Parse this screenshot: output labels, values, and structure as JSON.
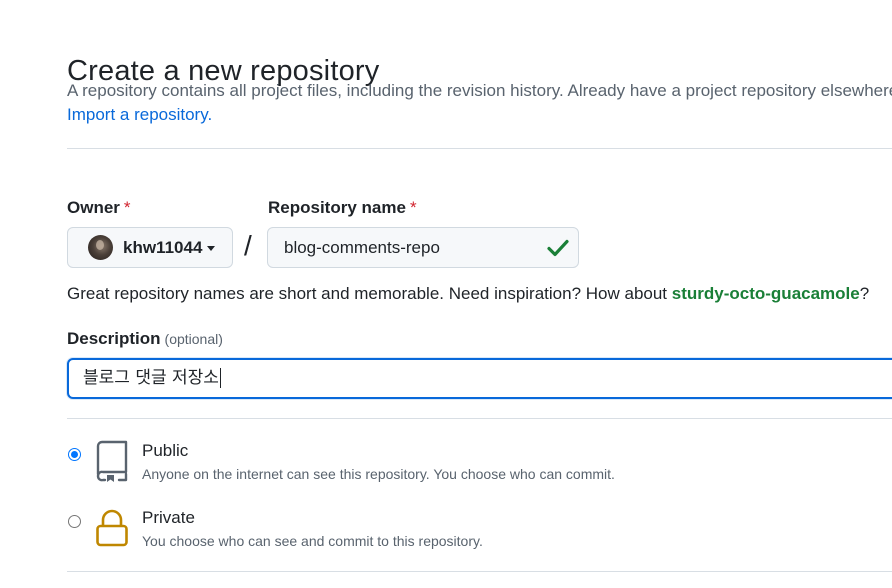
{
  "page": {
    "title": "Create a new repository",
    "intro": "A repository contains all project files, including the revision history. Already have a project repository elsewhere?",
    "import_link": "Import a repository."
  },
  "owner": {
    "label": "Owner",
    "required_mark": "*",
    "value": "khw11044"
  },
  "separator": "/",
  "repository_name": {
    "label": "Repository name",
    "required_mark": "*",
    "value": "blog-comments-repo",
    "status_icon": "check-icon"
  },
  "name_hint": {
    "text": "Great repository names are short and memorable. Need inspiration? How about ",
    "suggestion": "sturdy-octo-guacamole",
    "suffix": "?"
  },
  "description": {
    "label": "Description",
    "optional": "(optional)",
    "value": "블로그 댓글 저장소"
  },
  "visibility": {
    "options": [
      {
        "title": "Public",
        "description": "Anyone on the internet can see this repository. You choose who can commit.",
        "icon": "repo-icon",
        "selected": true
      },
      {
        "title": "Private",
        "description": "You choose who can see and commit to this repository.",
        "icon": "lock-icon",
        "selected": false
      }
    ]
  },
  "colors": {
    "link": "#0969da",
    "success": "#1a7f37",
    "required": "#d1242f",
    "focus_border": "#0969da",
    "lock_icon": "#bf8700"
  }
}
